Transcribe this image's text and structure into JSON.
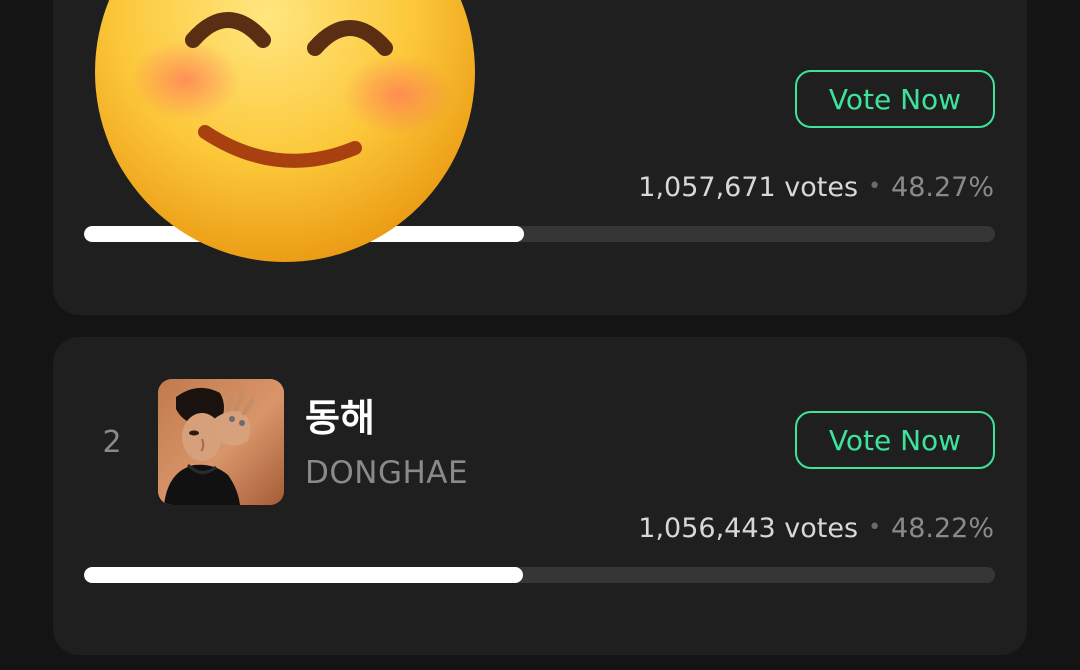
{
  "entries": [
    {
      "votes_text": "1,057,671 votes",
      "percent_text": "48.27%",
      "progress_fraction": 0.4827,
      "vote_button_label": "Vote Now"
    },
    {
      "rank": "2",
      "name": "동해",
      "subtitle": "DONGHAE",
      "votes_text": "1,056,443 votes",
      "percent_text": "48.22%",
      "progress_fraction": 0.4822,
      "vote_button_label": "Vote Now"
    }
  ],
  "separator": "•",
  "colors": {
    "background": "#141414",
    "card": "#1f1f1f",
    "accent_green": "#3ee39b",
    "progress_fill": "#ffffff",
    "progress_track": "#363636"
  },
  "icons": {
    "overlay": "smiling-face-emoji-icon"
  }
}
